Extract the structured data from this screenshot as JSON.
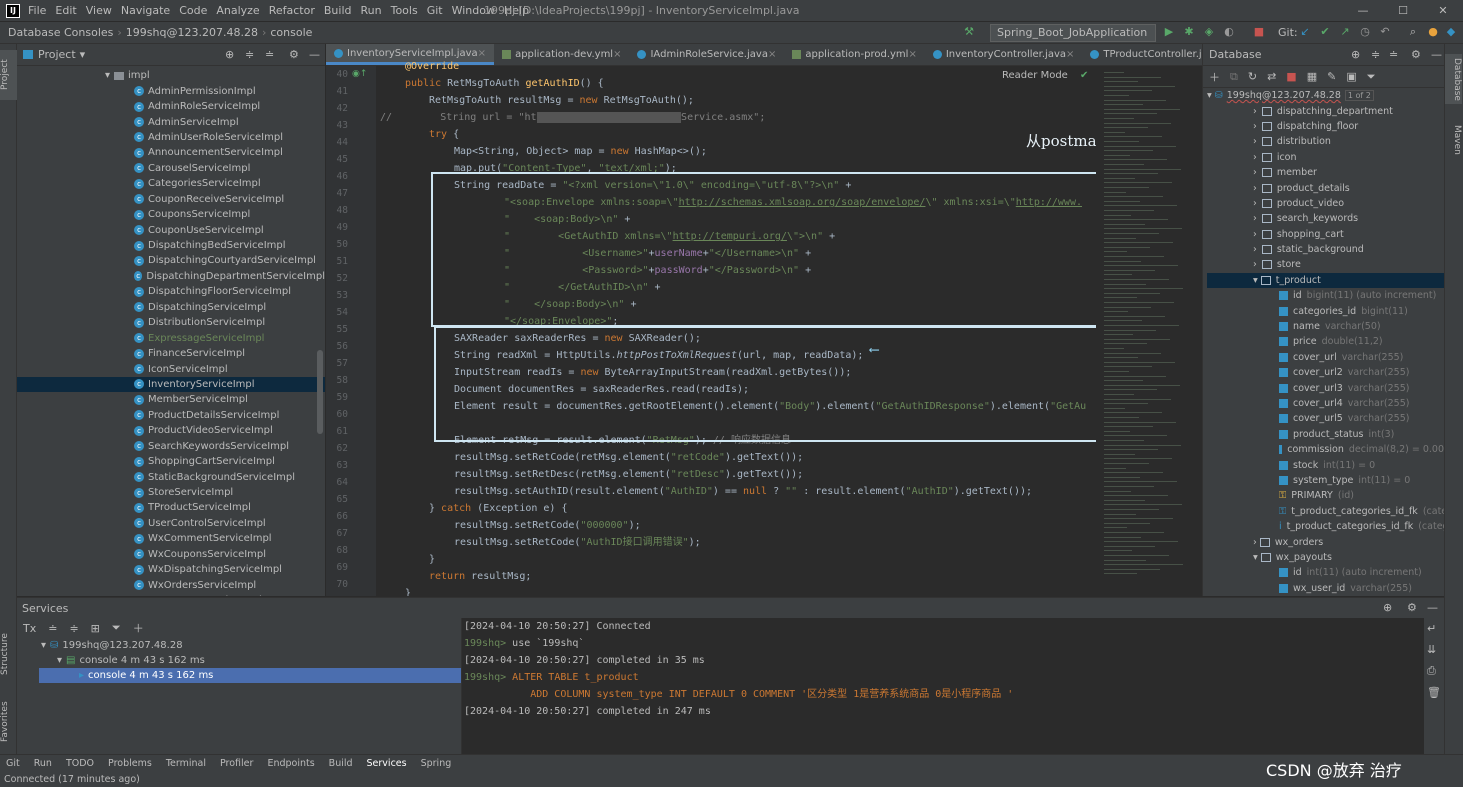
{
  "window": {
    "title": "199pj [D:\\IdeaProjects\\199pj] - InventoryServiceImpl.java",
    "menu": [
      "File",
      "Edit",
      "View",
      "Navigate",
      "Code",
      "Analyze",
      "Refactor",
      "Build",
      "Run",
      "Tools",
      "Git",
      "Window",
      "Help"
    ],
    "controls": [
      "—",
      "☐",
      "✕"
    ]
  },
  "navbar": {
    "crumbs": [
      "Database Consoles",
      "199shq@123.207.48.28",
      "console"
    ],
    "run_config": "Spring_Boot_JobApplication",
    "git_label": "Git:"
  },
  "project": {
    "title": "Project",
    "folder": "impl",
    "items": [
      "AdminPermissionImpl",
      "AdminRoleServiceImpl",
      "AdminServiceImpl",
      "AdminUserRoleServiceImpl",
      "AnnouncementServiceImpl",
      "CarouselServiceImpl",
      "CategoriesServiceImpl",
      "CouponReceiveServiceImpl",
      "CouponsServiceImpl",
      "CouponUseServiceImpl",
      "DispatchingBedServiceImpl",
      "DispatchingCourtyardServiceImpl",
      "DispatchingDepartmentServiceImpl",
      "DispatchingFloorServiceImpl",
      "DispatchingServiceImpl",
      "DistributionServiceImpl",
      "ExpressageServiceImpl",
      "FinanceServiceImpl",
      "IconServiceImpl",
      "InventoryServiceImpl",
      "MemberServiceImpl",
      "ProductDetailsServiceImpl",
      "ProductVideoServiceImpl",
      "SearchKeywordsServiceImpl",
      "ShoppingCartServiceImpl",
      "StaticBackgroundServiceImpl",
      "StoreServiceImpl",
      "TProductServiceImpl",
      "UserControlServiceImpl",
      "WxCommentServiceImpl",
      "WxCouponsServiceImpl",
      "WxDispatchingServiceImpl",
      "WxOrdersServiceImpl",
      "WxPayoutsServiceImpl"
    ],
    "selected": "InventoryServiceImpl",
    "highlight": "ExpressageServiceImpl"
  },
  "tabs": [
    "InventoryServiceImpl.java",
    "application-dev.yml",
    "IAdminRoleService.java",
    "application-prod.yml",
    "InventoryController.java",
    "TProductController.java"
  ],
  "editor": {
    "reader_mode": "Reader Mode",
    "annotation": "从postman中拿取的请求格式xml",
    "line_numbers": [
      "40",
      "41",
      "42",
      "43",
      "44",
      "45",
      "46",
      "47",
      "48",
      "49",
      "50",
      "51",
      "52",
      "53",
      "54",
      "55",
      "56",
      "57",
      "58",
      "59",
      "60",
      "61",
      "62",
      "63",
      "64",
      "65",
      "66",
      "67",
      "68",
      "69",
      "70"
    ]
  },
  "database": {
    "title": "Database",
    "connection": "199shq@123.207.48.28",
    "page": "1 of 2",
    "tables": [
      "dispatching_department",
      "dispatching_floor",
      "distribution",
      "icon",
      "member",
      "product_details",
      "product_video",
      "search_keywords",
      "shopping_cart",
      "static_background",
      "store"
    ],
    "t_product": "t_product",
    "columns": [
      {
        "name": "id",
        "type": "bigint(11) (auto increment)"
      },
      {
        "name": "categories_id",
        "type": "bigint(11)"
      },
      {
        "name": "name",
        "type": "varchar(50)"
      },
      {
        "name": "price",
        "type": "double(11,2)"
      },
      {
        "name": "cover_url",
        "type": "varchar(255)"
      },
      {
        "name": "cover_url2",
        "type": "varchar(255)"
      },
      {
        "name": "cover_url3",
        "type": "varchar(255)"
      },
      {
        "name": "cover_url4",
        "type": "varchar(255)"
      },
      {
        "name": "cover_url5",
        "type": "varchar(255)"
      },
      {
        "name": "product_status",
        "type": "int(3)"
      },
      {
        "name": "commission",
        "type": "decimal(8,2) = 0.00"
      },
      {
        "name": "stock",
        "type": "int(11) = 0"
      },
      {
        "name": "system_type",
        "type": "int(11) = 0"
      }
    ],
    "primary": "PRIMARY",
    "primary_type": "(id)",
    "fks": [
      "t_product_categories_id_fk",
      "t_product_categories_id_fk"
    ],
    "fk_suffix": "(categ",
    "after": [
      "wx_orders",
      "wx_payouts"
    ],
    "wx_cols": [
      {
        "name": "id",
        "type": "int(11) (auto increment)"
      },
      {
        "name": "wx_user_id",
        "type": "varchar(255)"
      }
    ]
  },
  "services": {
    "title": "Services",
    "tree": [
      "199shq@123.207.48.28",
      "console  4 m 43 s 162 ms",
      "console  4 m 43 s 162 ms"
    ]
  },
  "console_lines": [
    {
      "prompt": "",
      "text": "[2024-04-10 20:50:27] Connected"
    },
    {
      "prompt": "199shq>",
      "text": " use `199shq`"
    },
    {
      "prompt": "",
      "text": "[2024-04-10 20:50:27] completed in 35 ms"
    },
    {
      "prompt": "199shq>",
      "text": " ALTER TABLE t_product"
    },
    {
      "prompt": "",
      "text": "           ADD COLUMN system_type INT DEFAULT 0 COMMENT '区分类型 1是营养系统商品 0是小程序商品 '"
    },
    {
      "prompt": "",
      "text": "[2024-04-10 20:50:27] completed in 247 ms"
    }
  ],
  "bottom_tabs": [
    "Git",
    "Run",
    "TODO",
    "Problems",
    "Terminal",
    "Profiler",
    "Endpoints",
    "Build",
    "Services",
    "Spring"
  ],
  "active_bottom_tab": "Services",
  "status": "Connected (17 minutes ago)",
  "watermark": "CSDN @放弃    治疗",
  "side_tabs": {
    "left": [
      "Project",
      "Structure",
      "Favorites"
    ],
    "right": [
      "Database",
      "Maven"
    ]
  }
}
